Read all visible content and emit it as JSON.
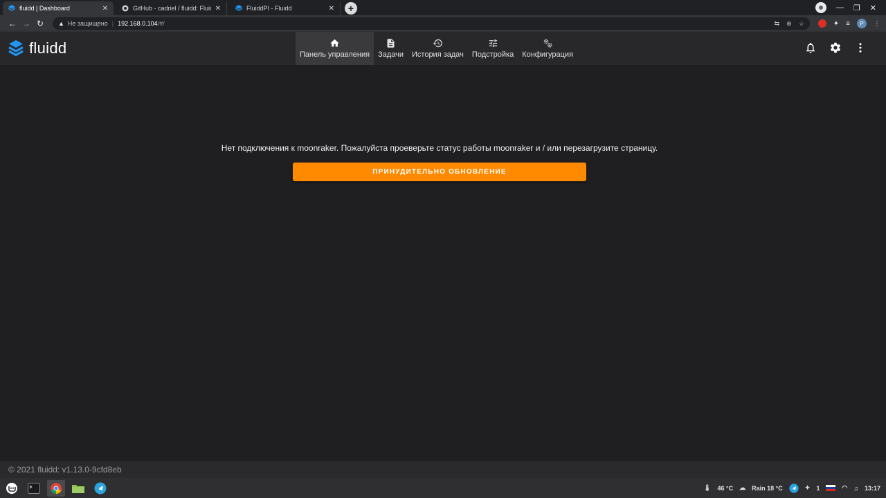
{
  "browser": {
    "tabs": [
      {
        "title": "fluidd | Dashboard",
        "active": true
      },
      {
        "title": "GitHub - cadriel / fluidd: Fluid",
        "active": false
      },
      {
        "title": "FluiddPI - Fluidd",
        "active": false
      }
    ],
    "close_glyph": "✕",
    "new_tab_glyph": "+",
    "address": {
      "security_label": "Не защищено",
      "host": "192.168.0.104",
      "path": "/#/"
    },
    "profile_initial": "P"
  },
  "app": {
    "brand": "fluidd",
    "brand_color": "#2196f3",
    "nav": [
      {
        "label": "Панель управления",
        "icon": "home-icon",
        "active": true
      },
      {
        "label": "Задачи",
        "icon": "file-icon",
        "active": false
      },
      {
        "label": "История задач",
        "icon": "history-icon",
        "active": false
      },
      {
        "label": "Подстройка",
        "icon": "tune-icon",
        "active": false
      },
      {
        "label": "Конфигурация",
        "icon": "cogs-icon",
        "active": false
      }
    ]
  },
  "main": {
    "message": "Нет подключения к moonraker. Пожалуйста проеверьте статус работы moonraker и / или перезагрузите страницу.",
    "button_label": "ПРИНУДИТЕЛЬНО ОБНОВЛЕНИЕ",
    "button_color": "#ff8a00"
  },
  "footer": {
    "text": "© 2021 fluidd: v1.13.0-9cfd8eb"
  },
  "taskbar": {
    "cpu_temp": "46 °C",
    "weather": "Rain 18 °C",
    "notif_count": "1",
    "time": "13:17"
  }
}
